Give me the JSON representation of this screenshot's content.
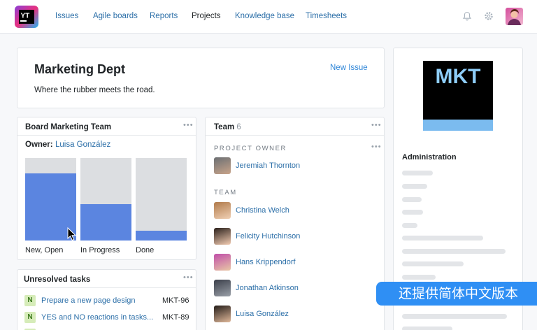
{
  "nav": {
    "items": [
      "Issues",
      "Agile boards",
      "Reports",
      "Projects",
      "Knowledge base",
      "Timesheets"
    ],
    "active": "Projects",
    "logo_text": "YT"
  },
  "header": {
    "title": "Marketing Dept",
    "subtitle": "Where the rubber meets the road.",
    "new_issue": "New Issue"
  },
  "board": {
    "title": "Board Marketing Team",
    "owner_label": "Owner:",
    "owner_name": "Luisa González"
  },
  "chart_data": {
    "type": "bar",
    "categories": [
      "New, Open",
      "In Progress",
      "Done"
    ],
    "values": [
      0.81,
      0.44,
      0.12
    ],
    "ylim": [
      0,
      1
    ]
  },
  "team": {
    "title": "Team",
    "count": "6",
    "owner_section": "PROJECT OWNER",
    "owner": "Jeremiah Thornton",
    "team_section": "TEAM",
    "members": [
      "Christina Welch",
      "Felicity Hutchinson",
      "Hans Krippendorf",
      "Jonathan Atkinson",
      "Luisa González"
    ]
  },
  "logo_card": {
    "logo_text": "MKT",
    "admin_title": "Administration"
  },
  "tasks": {
    "title": "Unresolved tasks",
    "items": [
      {
        "badge": "N",
        "title": "Prepare a new page design",
        "id": "MKT-96"
      },
      {
        "badge": "N",
        "title": "YES and NO reactions in tasks...",
        "id": "MKT-89"
      }
    ]
  },
  "overlay": {
    "banner": "还提供简体中文版本"
  },
  "colors": {
    "accent": "#2f86d8",
    "bar_fill": "#5b85e0",
    "bar_bg": "#dcdee1",
    "banner": "#2f8ff4"
  }
}
